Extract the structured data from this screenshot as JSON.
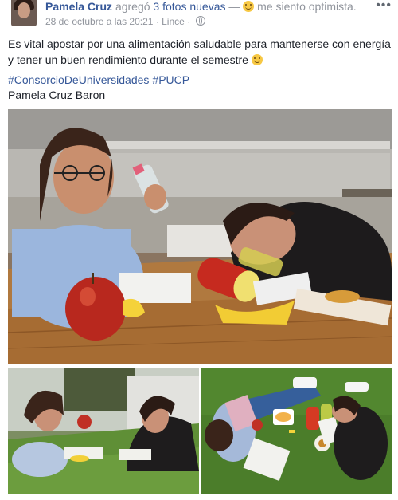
{
  "header": {
    "author": "Pamela Cruz",
    "action_pre": "agregó",
    "photos_link": "3 fotos nuevas",
    "action_sep": "—",
    "feeling": "me siento optimista.",
    "date": "28 de octubre a las 20:21",
    "dot": "·",
    "location": "Lince",
    "dot2": "·",
    "privacy_icon": "globe-icon",
    "more_label": "•••"
  },
  "post": {
    "text": "Es vital apostar por una alimentación saludable para mantenerse con energía y tener un buen rendimiento durante el semestre",
    "hashtags": [
      "#ConsorcioDeUniversidades",
      "#PUCP"
    ],
    "byline": "Pamela Cruz Baron"
  },
  "photos": {
    "count": 3,
    "icons": [
      "photo-students-table",
      "photo-students-grass",
      "photo-students-lawn-aerial"
    ]
  }
}
